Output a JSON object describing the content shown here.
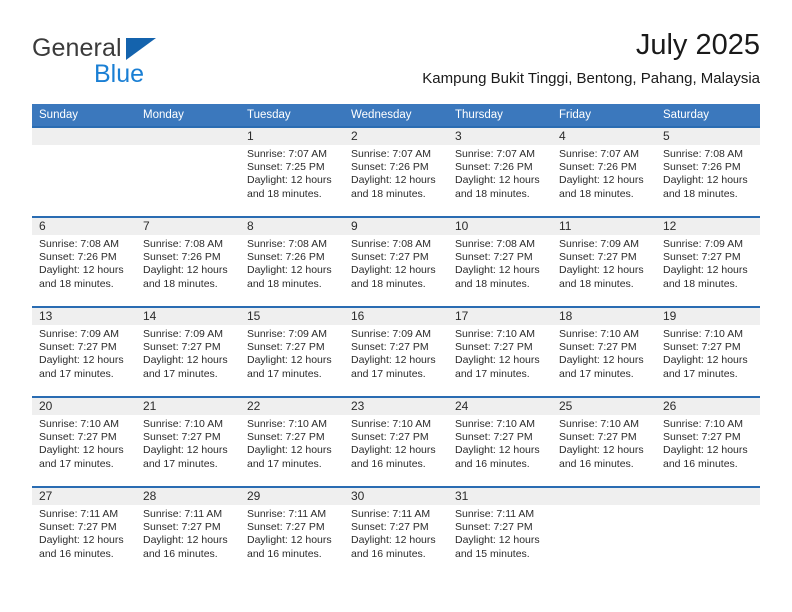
{
  "brand": {
    "name_part1": "General",
    "name_part2": "Blue",
    "triangle_icon": "brand-triangle-icon",
    "colors": {
      "general": "#3b3b3b",
      "blue": "#1a7fd4",
      "triangle": "#1463ad"
    }
  },
  "header": {
    "title": "July 2025",
    "subtitle": "Kampung Bukit Tinggi, Bentong, Pahang, Malaysia"
  },
  "theme": {
    "header_background": "#3b78bd",
    "row_divider": "#2a6cb2",
    "daynum_band": "#efefef",
    "text": "#2b2b2b"
  },
  "calendar": {
    "weekday_headers": [
      "Sunday",
      "Monday",
      "Tuesday",
      "Wednesday",
      "Thursday",
      "Friday",
      "Saturday"
    ],
    "weeks": [
      [
        {
          "day": "",
          "sunrise": "",
          "sunset": "",
          "daylight_line1": "",
          "daylight_line2": ""
        },
        {
          "day": "",
          "sunrise": "",
          "sunset": "",
          "daylight_line1": "",
          "daylight_line2": ""
        },
        {
          "day": "1",
          "sunrise": "Sunrise: 7:07 AM",
          "sunset": "Sunset: 7:25 PM",
          "daylight_line1": "Daylight: 12 hours",
          "daylight_line2": "and 18 minutes."
        },
        {
          "day": "2",
          "sunrise": "Sunrise: 7:07 AM",
          "sunset": "Sunset: 7:26 PM",
          "daylight_line1": "Daylight: 12 hours",
          "daylight_line2": "and 18 minutes."
        },
        {
          "day": "3",
          "sunrise": "Sunrise: 7:07 AM",
          "sunset": "Sunset: 7:26 PM",
          "daylight_line1": "Daylight: 12 hours",
          "daylight_line2": "and 18 minutes."
        },
        {
          "day": "4",
          "sunrise": "Sunrise: 7:07 AM",
          "sunset": "Sunset: 7:26 PM",
          "daylight_line1": "Daylight: 12 hours",
          "daylight_line2": "and 18 minutes."
        },
        {
          "day": "5",
          "sunrise": "Sunrise: 7:08 AM",
          "sunset": "Sunset: 7:26 PM",
          "daylight_line1": "Daylight: 12 hours",
          "daylight_line2": "and 18 minutes."
        }
      ],
      [
        {
          "day": "6",
          "sunrise": "Sunrise: 7:08 AM",
          "sunset": "Sunset: 7:26 PM",
          "daylight_line1": "Daylight: 12 hours",
          "daylight_line2": "and 18 minutes."
        },
        {
          "day": "7",
          "sunrise": "Sunrise: 7:08 AM",
          "sunset": "Sunset: 7:26 PM",
          "daylight_line1": "Daylight: 12 hours",
          "daylight_line2": "and 18 minutes."
        },
        {
          "day": "8",
          "sunrise": "Sunrise: 7:08 AM",
          "sunset": "Sunset: 7:26 PM",
          "daylight_line1": "Daylight: 12 hours",
          "daylight_line2": "and 18 minutes."
        },
        {
          "day": "9",
          "sunrise": "Sunrise: 7:08 AM",
          "sunset": "Sunset: 7:27 PM",
          "daylight_line1": "Daylight: 12 hours",
          "daylight_line2": "and 18 minutes."
        },
        {
          "day": "10",
          "sunrise": "Sunrise: 7:08 AM",
          "sunset": "Sunset: 7:27 PM",
          "daylight_line1": "Daylight: 12 hours",
          "daylight_line2": "and 18 minutes."
        },
        {
          "day": "11",
          "sunrise": "Sunrise: 7:09 AM",
          "sunset": "Sunset: 7:27 PM",
          "daylight_line1": "Daylight: 12 hours",
          "daylight_line2": "and 18 minutes."
        },
        {
          "day": "12",
          "sunrise": "Sunrise: 7:09 AM",
          "sunset": "Sunset: 7:27 PM",
          "daylight_line1": "Daylight: 12 hours",
          "daylight_line2": "and 18 minutes."
        }
      ],
      [
        {
          "day": "13",
          "sunrise": "Sunrise: 7:09 AM",
          "sunset": "Sunset: 7:27 PM",
          "daylight_line1": "Daylight: 12 hours",
          "daylight_line2": "and 17 minutes."
        },
        {
          "day": "14",
          "sunrise": "Sunrise: 7:09 AM",
          "sunset": "Sunset: 7:27 PM",
          "daylight_line1": "Daylight: 12 hours",
          "daylight_line2": "and 17 minutes."
        },
        {
          "day": "15",
          "sunrise": "Sunrise: 7:09 AM",
          "sunset": "Sunset: 7:27 PM",
          "daylight_line1": "Daylight: 12 hours",
          "daylight_line2": "and 17 minutes."
        },
        {
          "day": "16",
          "sunrise": "Sunrise: 7:09 AM",
          "sunset": "Sunset: 7:27 PM",
          "daylight_line1": "Daylight: 12 hours",
          "daylight_line2": "and 17 minutes."
        },
        {
          "day": "17",
          "sunrise": "Sunrise: 7:10 AM",
          "sunset": "Sunset: 7:27 PM",
          "daylight_line1": "Daylight: 12 hours",
          "daylight_line2": "and 17 minutes."
        },
        {
          "day": "18",
          "sunrise": "Sunrise: 7:10 AM",
          "sunset": "Sunset: 7:27 PM",
          "daylight_line1": "Daylight: 12 hours",
          "daylight_line2": "and 17 minutes."
        },
        {
          "day": "19",
          "sunrise": "Sunrise: 7:10 AM",
          "sunset": "Sunset: 7:27 PM",
          "daylight_line1": "Daylight: 12 hours",
          "daylight_line2": "and 17 minutes."
        }
      ],
      [
        {
          "day": "20",
          "sunrise": "Sunrise: 7:10 AM",
          "sunset": "Sunset: 7:27 PM",
          "daylight_line1": "Daylight: 12 hours",
          "daylight_line2": "and 17 minutes."
        },
        {
          "day": "21",
          "sunrise": "Sunrise: 7:10 AM",
          "sunset": "Sunset: 7:27 PM",
          "daylight_line1": "Daylight: 12 hours",
          "daylight_line2": "and 17 minutes."
        },
        {
          "day": "22",
          "sunrise": "Sunrise: 7:10 AM",
          "sunset": "Sunset: 7:27 PM",
          "daylight_line1": "Daylight: 12 hours",
          "daylight_line2": "and 17 minutes."
        },
        {
          "day": "23",
          "sunrise": "Sunrise: 7:10 AM",
          "sunset": "Sunset: 7:27 PM",
          "daylight_line1": "Daylight: 12 hours",
          "daylight_line2": "and 16 minutes."
        },
        {
          "day": "24",
          "sunrise": "Sunrise: 7:10 AM",
          "sunset": "Sunset: 7:27 PM",
          "daylight_line1": "Daylight: 12 hours",
          "daylight_line2": "and 16 minutes."
        },
        {
          "day": "25",
          "sunrise": "Sunrise: 7:10 AM",
          "sunset": "Sunset: 7:27 PM",
          "daylight_line1": "Daylight: 12 hours",
          "daylight_line2": "and 16 minutes."
        },
        {
          "day": "26",
          "sunrise": "Sunrise: 7:10 AM",
          "sunset": "Sunset: 7:27 PM",
          "daylight_line1": "Daylight: 12 hours",
          "daylight_line2": "and 16 minutes."
        }
      ],
      [
        {
          "day": "27",
          "sunrise": "Sunrise: 7:11 AM",
          "sunset": "Sunset: 7:27 PM",
          "daylight_line1": "Daylight: 12 hours",
          "daylight_line2": "and 16 minutes."
        },
        {
          "day": "28",
          "sunrise": "Sunrise: 7:11 AM",
          "sunset": "Sunset: 7:27 PM",
          "daylight_line1": "Daylight: 12 hours",
          "daylight_line2": "and 16 minutes."
        },
        {
          "day": "29",
          "sunrise": "Sunrise: 7:11 AM",
          "sunset": "Sunset: 7:27 PM",
          "daylight_line1": "Daylight: 12 hours",
          "daylight_line2": "and 16 minutes."
        },
        {
          "day": "30",
          "sunrise": "Sunrise: 7:11 AM",
          "sunset": "Sunset: 7:27 PM",
          "daylight_line1": "Daylight: 12 hours",
          "daylight_line2": "and 16 minutes."
        },
        {
          "day": "31",
          "sunrise": "Sunrise: 7:11 AM",
          "sunset": "Sunset: 7:27 PM",
          "daylight_line1": "Daylight: 12 hours",
          "daylight_line2": "and 15 minutes."
        },
        {
          "day": "",
          "sunrise": "",
          "sunset": "",
          "daylight_line1": "",
          "daylight_line2": ""
        },
        {
          "day": "",
          "sunrise": "",
          "sunset": "",
          "daylight_line1": "",
          "daylight_line2": ""
        }
      ]
    ]
  }
}
